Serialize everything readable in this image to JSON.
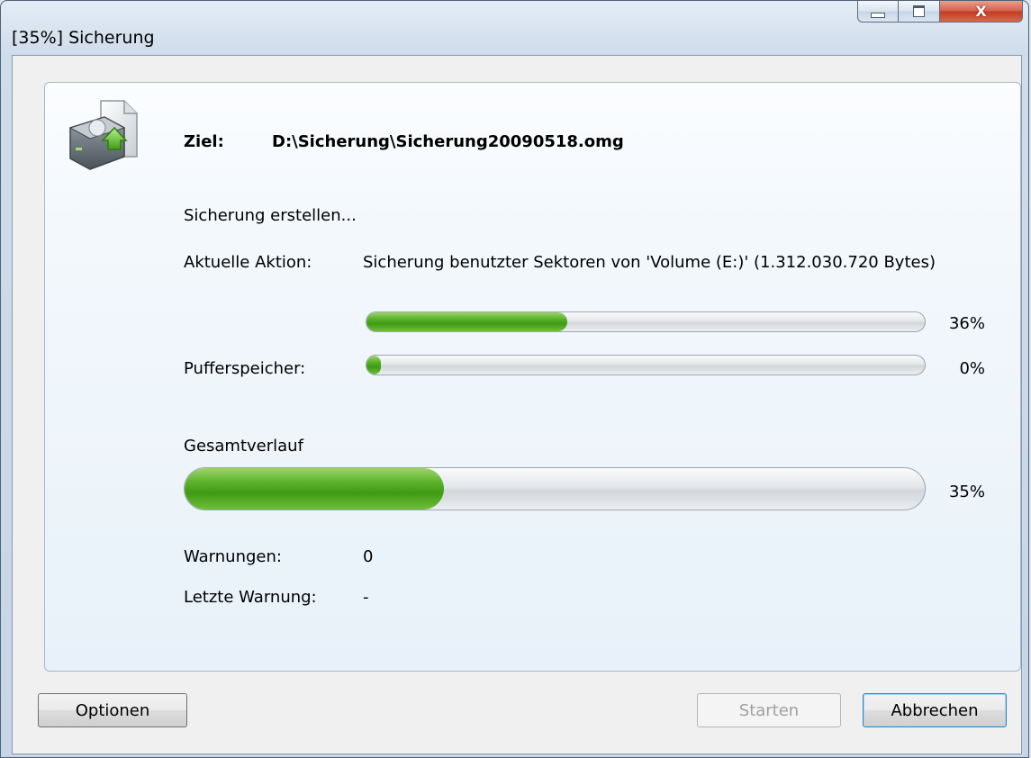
{
  "window": {
    "title": "[35%] Sicherung",
    "close_glyph": "X"
  },
  "header": {
    "target_label": "Ziel:",
    "target_path": "D:\\Sicherung\\Sicherung20090518.omg",
    "icon": "backup-drive-icon"
  },
  "status": {
    "message": "Sicherung erstellen...",
    "current_action_label": "Aktuelle Aktion:",
    "current_action_value": "Sicherung benutzter Sektoren von 'Volume (E:)' (1.312.030.720 Bytes)"
  },
  "progress": {
    "action": {
      "value": 0.36,
      "text": "36%"
    },
    "buffer": {
      "label": "Pufferspeicher:",
      "value": 0.0,
      "text": "0%"
    },
    "overall": {
      "label": "Gesamtverlauf",
      "value": 0.35,
      "text": "35%"
    }
  },
  "warnings": {
    "count_label": "Warnungen:",
    "count_value": "0",
    "last_label": "Letzte Warnung:",
    "last_value": "-"
  },
  "buttons": {
    "options": "Optionen",
    "start": "Starten",
    "cancel": "Abbrechen"
  },
  "colors": {
    "progress_green": "#4aa51c",
    "panel_border": "#a9b8c8"
  }
}
